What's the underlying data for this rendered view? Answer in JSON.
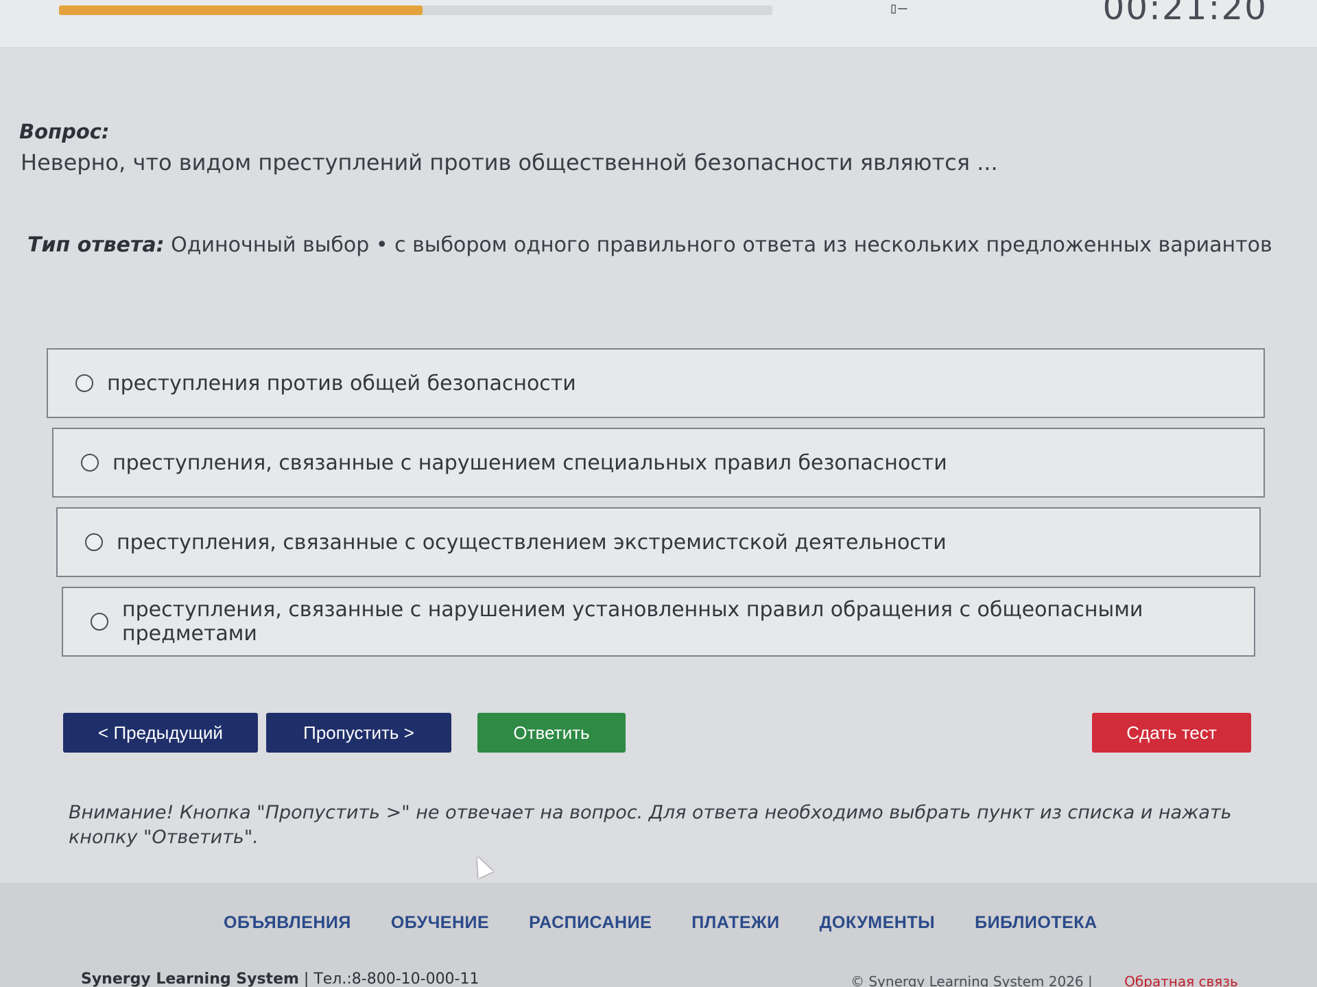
{
  "top": {
    "progress_fraction": 0.51,
    "icon": "window-icon",
    "timer": "00:21:20"
  },
  "question": {
    "label": "Вопрос:",
    "text": "Неверно, что видом преступлений против общественной безопасности являются ..."
  },
  "answer_type": {
    "label": "Тип ответа:",
    "text": "Одиночный выбор • с выбором одного правильного ответа из нескольких предложенных вариантов"
  },
  "options": [
    {
      "label": "преступления против общей безопасности"
    },
    {
      "label": "преступления, связанные с нарушением специальных правил безопасности"
    },
    {
      "label": "преступления, связанные с осуществлением экстремистской деятельности"
    },
    {
      "label": "преступления, связанные с нарушением установленных правил обращения с общеопасными предметами"
    }
  ],
  "buttons": {
    "prev": "< Предыдущий",
    "skip": "Пропустить >",
    "answer": "Ответить",
    "submit": "Сдать тест"
  },
  "notice": "Внимание! Кнопка \"Пропустить >\" не отвечает на вопрос. Для ответа необходимо выбрать пункт из списка и нажать кнопку \"Ответить\".",
  "nav": {
    "items": [
      "ОБЪЯВЛЕНИЯ",
      "ОБУЧЕНИЕ",
      "РАСПИСАНИЕ",
      "ПЛАТЕЖИ",
      "ДОКУМЕНТЫ",
      "БИБЛИОТЕКА"
    ]
  },
  "footer": {
    "brand": "Synergy Learning System",
    "phone": "Тел.:8-800-10-000-11",
    "copyright": "© Synergy Learning System 2026",
    "feedback": "Обратная связь"
  },
  "colors": {
    "primary_button": "#1f2f6a",
    "answer_button": "#2e8a44",
    "submit_button": "#d12c3a",
    "progress": "#e3a23b",
    "nav_link": "#2a4a8a"
  }
}
